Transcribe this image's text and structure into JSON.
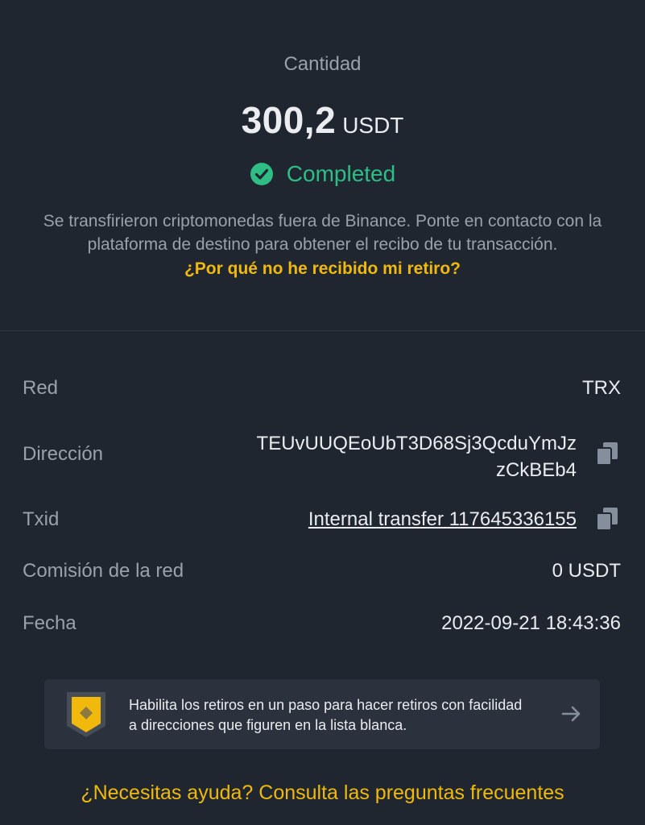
{
  "header": {
    "amount_label": "Cantidad",
    "amount_value": "300,2",
    "amount_unit": "USDT",
    "status_icon": "check-circle-icon",
    "status": "Completed",
    "status_color": "#2ebd85",
    "description": "Se transfirieron criptomonedas fuera de Binance. Ponte en contacto con la plataforma de destino para obtener el recibo de tu transacción.",
    "why_link": "¿Por qué no he recibido mi retiro?"
  },
  "details": {
    "network": {
      "label": "Red",
      "value": "TRX"
    },
    "address": {
      "label": "Dirección",
      "line1": "TEUvUUQEoUbT3D68Sj3QcduYmJz",
      "line2": "zCkBEb4",
      "copy_icon": "copy-icon"
    },
    "txid": {
      "label": "Txid",
      "value": "Internal transfer 117645336155",
      "copy_icon": "copy-icon"
    },
    "fee": {
      "label": "Comisión de la red",
      "value": "0 USDT"
    },
    "date": {
      "label": "Fecha",
      "value": "2022-09-21 18:43:36"
    }
  },
  "promo": {
    "icon": "shield-icon",
    "text": "Habilita los retiros en un paso para hacer retiros con facilidad a direcciones que figuren en la lista blanca.",
    "arrow_icon": "arrow-right-icon"
  },
  "help_link": "¿Necesitas ayuda? Consulta las preguntas frecuentes",
  "colors": {
    "background": "#1f2630",
    "accent": "#f0b90b",
    "success": "#2ebd85",
    "muted_text": "#9aa1ab",
    "card": "#2b323d"
  }
}
